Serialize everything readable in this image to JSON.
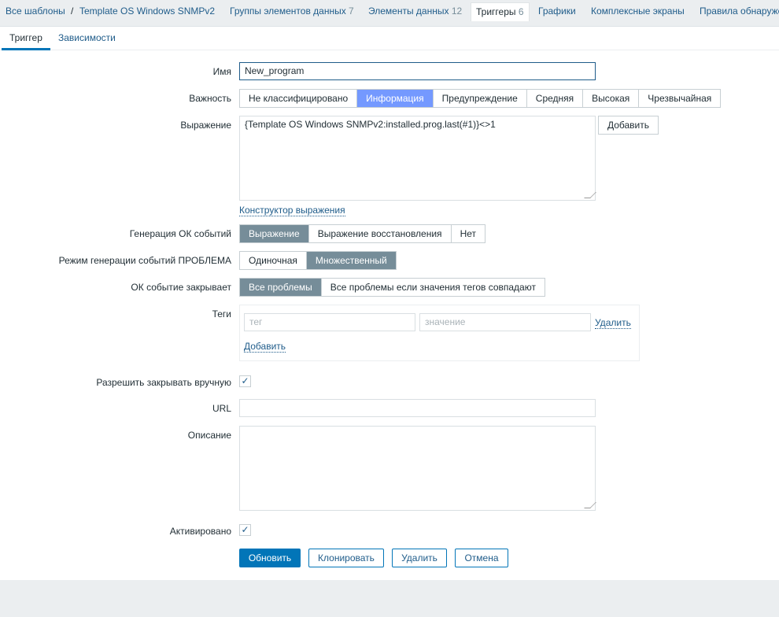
{
  "nav": {
    "all_templates": "Все шаблоны",
    "separator": "/",
    "template": "Template OS Windows SNMPv2",
    "items": [
      {
        "label": "Группы элементов данных",
        "count": "7"
      },
      {
        "label": "Элементы данных",
        "count": "12"
      },
      {
        "label": "Триггеры",
        "count": "6"
      },
      {
        "label": "Графики",
        "count": ""
      },
      {
        "label": "Комплексные экраны",
        "count": ""
      },
      {
        "label": "Правила обнаруже",
        "count": ""
      }
    ]
  },
  "tabs": [
    "Триггер",
    "Зависимости"
  ],
  "form": {
    "name_label": "Имя",
    "name_value": "New_program",
    "severity_label": "Важность",
    "severity": [
      "Не классифицировано",
      "Информация",
      "Предупреждение",
      "Средняя",
      "Высокая",
      "Чрезвычайная"
    ],
    "expr_label": "Выражение",
    "expr_value": "{Template OS Windows SNMPv2:installed.prog.last(#1)}<>1",
    "add_button": "Добавить",
    "constructor_link": "Конструктор выражения",
    "ok_gen_label": "Генерация ОК событий",
    "ok_gen": [
      "Выражение",
      "Выражение восстановления",
      "Нет"
    ],
    "problem_mode_label": "Режим генерации событий ПРОБЛЕМА",
    "problem_mode": [
      "Одиночная",
      "Множественный"
    ],
    "ok_close_label": "ОК событие закрывает",
    "ok_close": [
      "Все проблемы",
      "Все проблемы если значения тегов совпадают"
    ],
    "tags_label": "Теги",
    "tag_placeholder": "тег",
    "value_placeholder": "значение",
    "tag_remove": "Удалить",
    "tag_add": "Добавить",
    "manual_close_label": "Разрешить закрывать вручную",
    "manual_close_checked": true,
    "url_label": "URL",
    "url_value": "",
    "desc_label": "Описание",
    "desc_value": "",
    "enabled_label": "Активировано",
    "enabled_checked": true,
    "checkmark": "✓"
  },
  "buttons": {
    "update": "Обновить",
    "clone": "Клонировать",
    "delete": "Удалить",
    "cancel": "Отмена"
  }
}
